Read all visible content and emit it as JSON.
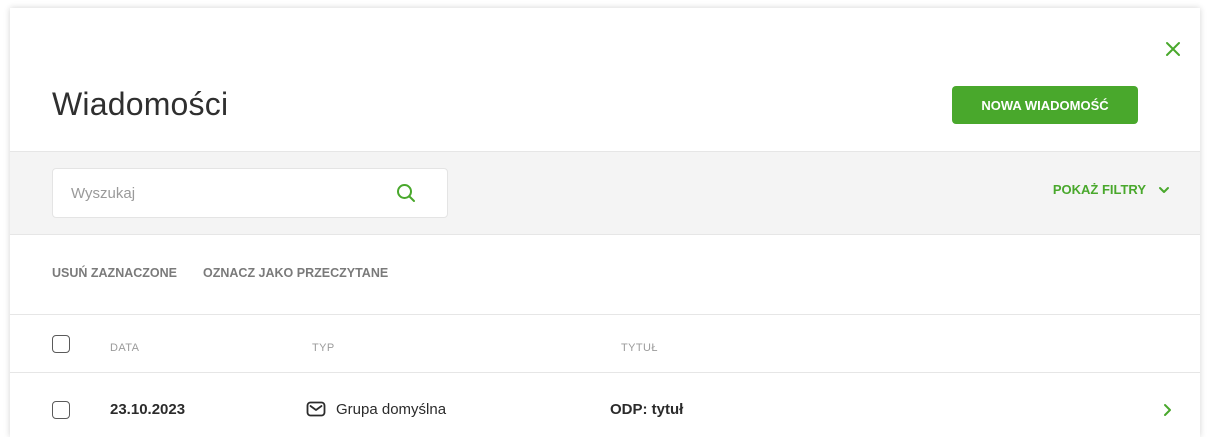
{
  "header": {
    "title": "Wiadomości",
    "new_message_label": "NOWA WIADOMOŚĆ",
    "close_icon": "close-icon"
  },
  "search": {
    "placeholder": "Wyszukaj",
    "value": "",
    "icon": "search-icon",
    "filters_label": "POKAŻ FILTRY"
  },
  "actions": {
    "delete_selected": "USUŃ ZAZNACZONE",
    "mark_read": "OZNACZ JAKO PRZECZYTANE"
  },
  "table": {
    "columns": [
      "DATA",
      "TYP",
      "TYTUŁ"
    ],
    "rows": [
      {
        "date": "23.10.2023",
        "type": "Grupa domyślna",
        "type_icon": "envelope-icon",
        "title": "ODP: tytuł"
      }
    ]
  },
  "colors": {
    "accent": "#49a82c",
    "band": "#f4f4f4",
    "muted": "#9b9b9b"
  }
}
